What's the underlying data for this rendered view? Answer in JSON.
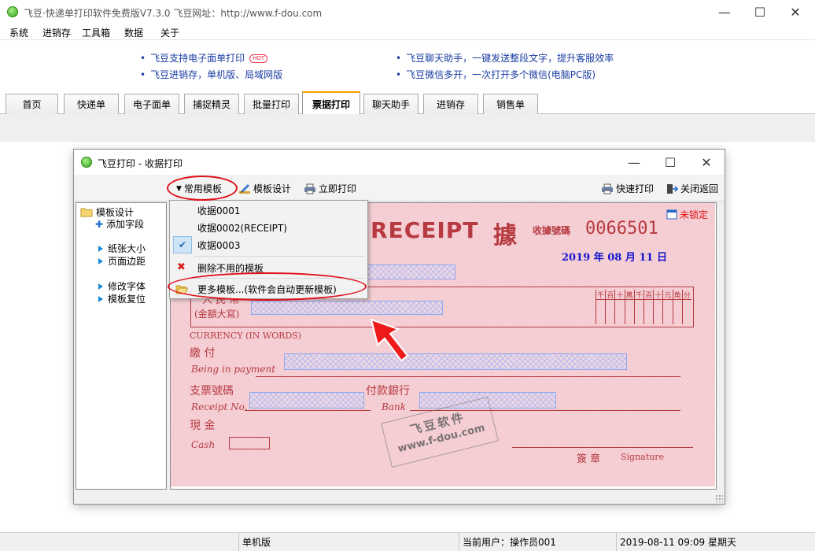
{
  "window": {
    "title": "飞豆·快递单打印软件免费版V7.3.0   飞豆网址：http://www.f-dou.com",
    "minimize": "—",
    "maximize": "☐",
    "close": "✕"
  },
  "menu": [
    "系统",
    "进销存",
    "工具箱",
    "数据",
    "关于"
  ],
  "ads": {
    "left": [
      "飞豆支持电子面单打印",
      "飞豆进销存，单机版、局域网版"
    ],
    "hot_badge": "HOT",
    "right": [
      "飞豆聊天助手，一键发送整段文字，提升客服效率",
      "飞豆微信多开，一次打开多个微信(电脑PC版)"
    ]
  },
  "tabs": [
    "首页",
    "快递单",
    "电子面单",
    "捕捉精灵",
    "批量打印",
    "票据打印",
    "聊天助手",
    "进销存",
    "销售单"
  ],
  "active_tab": "票据打印",
  "dialog": {
    "title": "飞豆打印 - 收据打印",
    "toolbar": {
      "templates": "常用模板",
      "design": "模板设计",
      "print_now": "立即打印",
      "quick_print": "快速打印",
      "close_return": "关闭返回"
    },
    "side": {
      "root": "模板设计",
      "items": [
        "添加字段",
        "纸张大小",
        "页面边距",
        "修改字体",
        "模板复位"
      ]
    },
    "lock_label": "未锁定",
    "dropdown": {
      "items": [
        "收据0001",
        "收据0002(RECEIPT)",
        "收据0003"
      ],
      "checked": "收据0003",
      "delete": "删除不用的模板",
      "more": "更多模板...(软件会自动更新模板)"
    },
    "receipt": {
      "title_en": "RECEIPT",
      "title_cn": "據",
      "no_label": "收據號碼",
      "number": "0066501",
      "date": "2019 年 08 月  11 日",
      "rmb_label": "人 民 幣",
      "amount_label": "(金額大寫)",
      "digit_headers": [
        "千",
        "百",
        "十",
        "萬",
        "千",
        "百",
        "十",
        "元",
        "角",
        "分"
      ],
      "currency_label": "CURRENCY (IN WORDS)",
      "pay_label": "繳   付",
      "pay_en": "Being in payment",
      "cheque_label": "支票號碼",
      "bank_label": "付款銀行",
      "receipt_no_en": "Receipt No.",
      "bank_en": "Bank",
      "cash_label": "現  金",
      "cash_en": "Cash",
      "sign_label": "簽  章",
      "sign_en": "Signature",
      "watermark_1": "飞豆软件",
      "watermark_2": "www.f-dou.com"
    }
  },
  "status": {
    "mode": "单机版",
    "user": "当前用户：操作员001",
    "datetime": "2019-08-11  09:09  星期天"
  }
}
